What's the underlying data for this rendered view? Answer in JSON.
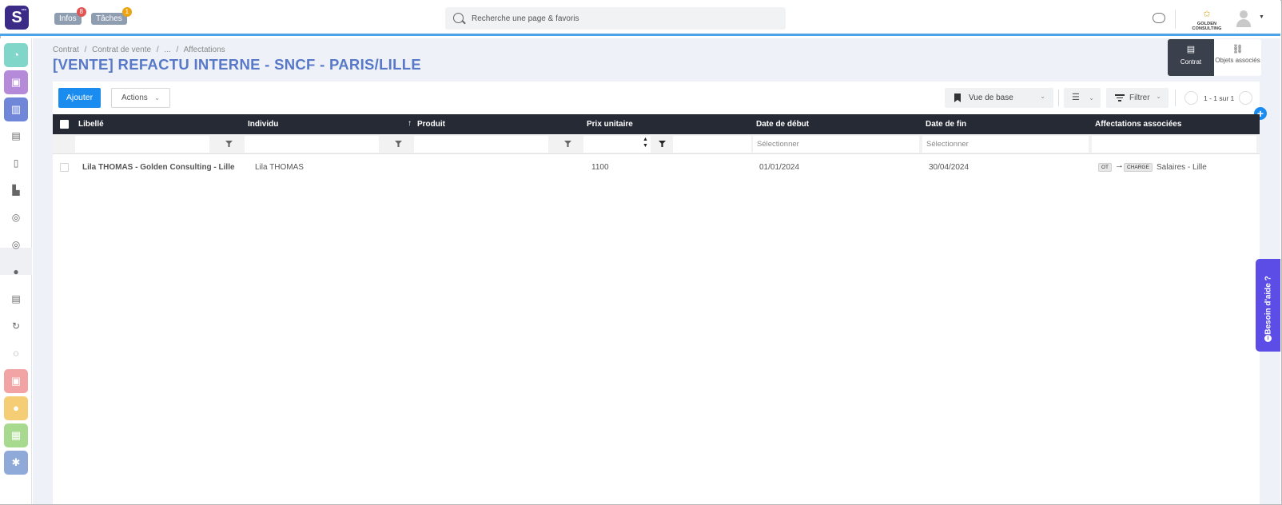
{
  "app": {
    "logo_letter": "S",
    "infos": {
      "label": "Infos",
      "count": "8"
    },
    "taches": {
      "label": "Tâches",
      "count": "1"
    },
    "search": {
      "placeholder": "Recherche une page & favoris"
    },
    "company": {
      "name": "GOLDEN CONSULTING"
    }
  },
  "sidebar": {
    "items": [
      {
        "icon": "dashboard-icon",
        "color": "#7fd6c9"
      },
      {
        "icon": "briefcase-icon",
        "color": "#b48ad9"
      },
      {
        "icon": "bar-chart-icon",
        "color": "#6f86d9"
      },
      {
        "icon": "calendar-icon"
      },
      {
        "icon": "documents-icon"
      },
      {
        "icon": "factory-icon"
      },
      {
        "icon": "euro-in-icon",
        "active": true
      },
      {
        "icon": "euro-out-icon"
      },
      {
        "icon": "user-icon"
      },
      {
        "icon": "report-icon"
      },
      {
        "icon": "refresh-euro-icon"
      },
      {
        "icon": "analytics-icon"
      },
      {
        "icon": "suitcase-icon",
        "color": "#f2a3a3"
      },
      {
        "icon": "coin-icon",
        "color": "#f5cd74"
      },
      {
        "icon": "team-icon",
        "color": "#a7d98f"
      },
      {
        "icon": "settings-icon",
        "color": "#8fa9d9"
      }
    ]
  },
  "page": {
    "breadcrumb": [
      "Contrat",
      "/",
      "Contrat de vente",
      "/",
      "...",
      "/",
      "Affectations"
    ],
    "title": "[VENTE] REFACTU INTERNE - SNCF - PARIS/LILLE",
    "tabs": [
      {
        "label": "Contrat",
        "icon": "document-icon"
      },
      {
        "label": "Objets associés",
        "icon": "link-icon"
      }
    ]
  },
  "toolbar": {
    "add_label": "Ajouter",
    "actions_label": "Actions",
    "view_label": "Vue de base",
    "filter_label": "Filtrer",
    "pagination": "1 - 1 sur 1"
  },
  "table": {
    "columns": [
      "Libellé",
      "Individu",
      "Produit",
      "Prix unitaire",
      "Date de début",
      "Date de fin",
      "Affectations associées"
    ],
    "filter_placeholder": "Sélectionner",
    "rows": [
      {
        "libelle": "Lila THOMAS - Golden Consulting - Lille",
        "individu": "Lila THOMAS",
        "produit": "",
        "prix": "1100",
        "debut": "01/01/2024",
        "fin": "30/04/2024",
        "aff_from": "OT",
        "aff_to": "CHARGE",
        "aff_label": "Salaires - Lille"
      }
    ]
  },
  "help": {
    "label": "Besoin d'aide ?"
  },
  "colors": {
    "accent": "#1a8cf0",
    "title": "#5878c8",
    "header": "#262a35",
    "help": "#5b4de6"
  }
}
